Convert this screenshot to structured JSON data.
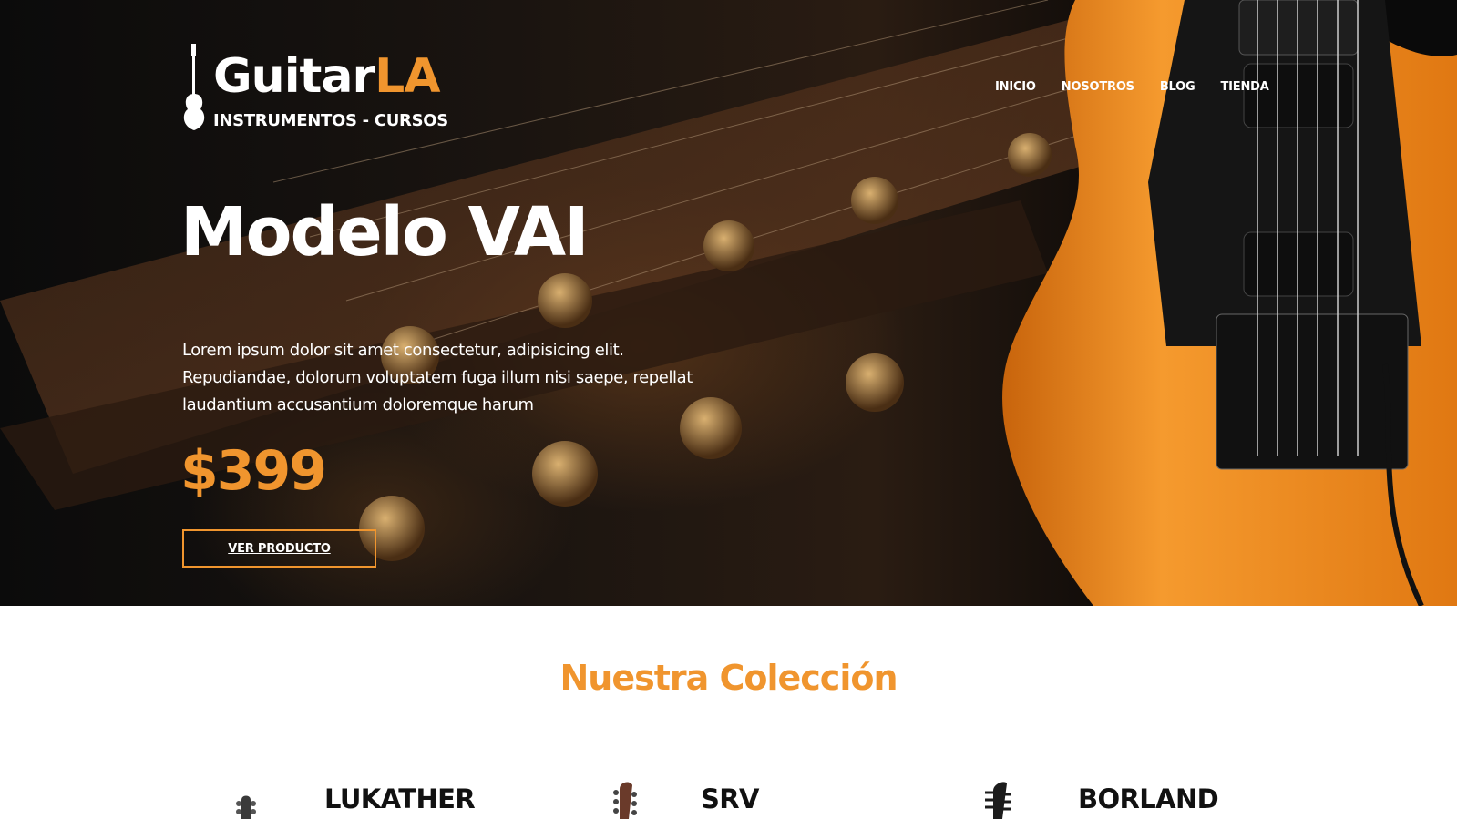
{
  "header": {
    "logo": {
      "word_white": "Guitar",
      "word_accent": "LA",
      "tagline": "INSTRUMENTOS - CURSOS"
    },
    "nav": [
      {
        "label": "INICIO"
      },
      {
        "label": "NOSOTROS"
      },
      {
        "label": "BLOG"
      },
      {
        "label": "TIENDA"
      }
    ]
  },
  "hero": {
    "title": "Modelo VAI",
    "description": "Lorem ipsum dolor sit amet consectetur, adipisicing elit. Repudiandae, dolorum voluptatem fuga illum nisi saepe, repellat laudantium accusantium doloremque harum",
    "price": "$399",
    "cta_label": "VER PRODUCTO",
    "image_icon": "guitar-photo"
  },
  "collection": {
    "heading": "Nuestra Colección",
    "products": [
      {
        "name": "LUKATHER",
        "icon": "guitar-headstock-icon"
      },
      {
        "name": "SRV",
        "icon": "guitar-headstock-icon"
      },
      {
        "name": "BORLAND",
        "icon": "guitar-headstock-icon"
      }
    ]
  },
  "colors": {
    "accent": "#f0952e",
    "hero_bg": "#111111",
    "text_light": "#ffffff",
    "text_dark": "#111111",
    "guitar_body": "#f28a1c"
  }
}
